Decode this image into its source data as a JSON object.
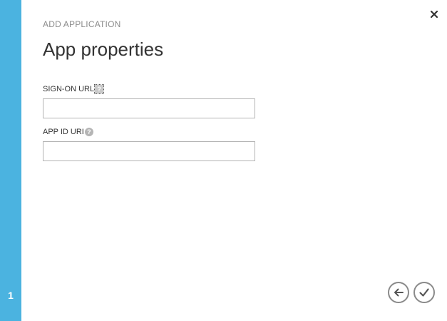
{
  "wizard": {
    "step_number": "1",
    "header_label": "ADD APPLICATION",
    "title": "App properties"
  },
  "fields": {
    "sign_on_url": {
      "label": "SIGN-ON URL",
      "value": "",
      "placeholder": "",
      "help_icon": "question-mark-icon"
    },
    "app_id_uri": {
      "label": "APP ID URI",
      "value": "",
      "placeholder": "",
      "help_icon": "question-mark-icon"
    }
  },
  "icons": {
    "close": "close-icon",
    "back": "arrow-left-icon",
    "complete": "checkmark-icon",
    "help_glyph": "?"
  },
  "colors": {
    "accent": "#4bb3e0",
    "title_text": "#333333",
    "muted_text": "#8c8c8c",
    "input_border": "#b3b3b3",
    "nav_button_border": "#8a8a8a"
  }
}
